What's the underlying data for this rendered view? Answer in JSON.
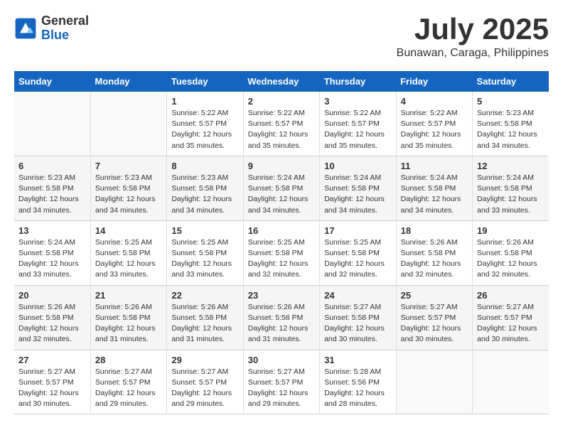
{
  "logo": {
    "general": "General",
    "blue": "Blue"
  },
  "title": {
    "month": "July 2025",
    "location": "Bunawan, Caraga, Philippines"
  },
  "days_of_week": [
    "Sunday",
    "Monday",
    "Tuesday",
    "Wednesday",
    "Thursday",
    "Friday",
    "Saturday"
  ],
  "weeks": [
    [
      {
        "day": "",
        "info": ""
      },
      {
        "day": "",
        "info": ""
      },
      {
        "day": "1",
        "info": "Sunrise: 5:22 AM\nSunset: 5:57 PM\nDaylight: 12 hours and 35 minutes."
      },
      {
        "day": "2",
        "info": "Sunrise: 5:22 AM\nSunset: 5:57 PM\nDaylight: 12 hours and 35 minutes."
      },
      {
        "day": "3",
        "info": "Sunrise: 5:22 AM\nSunset: 5:57 PM\nDaylight: 12 hours and 35 minutes."
      },
      {
        "day": "4",
        "info": "Sunrise: 5:22 AM\nSunset: 5:57 PM\nDaylight: 12 hours and 35 minutes."
      },
      {
        "day": "5",
        "info": "Sunrise: 5:23 AM\nSunset: 5:58 PM\nDaylight: 12 hours and 34 minutes."
      }
    ],
    [
      {
        "day": "6",
        "info": "Sunrise: 5:23 AM\nSunset: 5:58 PM\nDaylight: 12 hours and 34 minutes."
      },
      {
        "day": "7",
        "info": "Sunrise: 5:23 AM\nSunset: 5:58 PM\nDaylight: 12 hours and 34 minutes."
      },
      {
        "day": "8",
        "info": "Sunrise: 5:23 AM\nSunset: 5:58 PM\nDaylight: 12 hours and 34 minutes."
      },
      {
        "day": "9",
        "info": "Sunrise: 5:24 AM\nSunset: 5:58 PM\nDaylight: 12 hours and 34 minutes."
      },
      {
        "day": "10",
        "info": "Sunrise: 5:24 AM\nSunset: 5:58 PM\nDaylight: 12 hours and 34 minutes."
      },
      {
        "day": "11",
        "info": "Sunrise: 5:24 AM\nSunset: 5:58 PM\nDaylight: 12 hours and 34 minutes."
      },
      {
        "day": "12",
        "info": "Sunrise: 5:24 AM\nSunset: 5:58 PM\nDaylight: 12 hours and 33 minutes."
      }
    ],
    [
      {
        "day": "13",
        "info": "Sunrise: 5:24 AM\nSunset: 5:58 PM\nDaylight: 12 hours and 33 minutes."
      },
      {
        "day": "14",
        "info": "Sunrise: 5:25 AM\nSunset: 5:58 PM\nDaylight: 12 hours and 33 minutes."
      },
      {
        "day": "15",
        "info": "Sunrise: 5:25 AM\nSunset: 5:58 PM\nDaylight: 12 hours and 33 minutes."
      },
      {
        "day": "16",
        "info": "Sunrise: 5:25 AM\nSunset: 5:58 PM\nDaylight: 12 hours and 32 minutes."
      },
      {
        "day": "17",
        "info": "Sunrise: 5:25 AM\nSunset: 5:58 PM\nDaylight: 12 hours and 32 minutes."
      },
      {
        "day": "18",
        "info": "Sunrise: 5:26 AM\nSunset: 5:58 PM\nDaylight: 12 hours and 32 minutes."
      },
      {
        "day": "19",
        "info": "Sunrise: 5:26 AM\nSunset: 5:58 PM\nDaylight: 12 hours and 32 minutes."
      }
    ],
    [
      {
        "day": "20",
        "info": "Sunrise: 5:26 AM\nSunset: 5:58 PM\nDaylight: 12 hours and 32 minutes."
      },
      {
        "day": "21",
        "info": "Sunrise: 5:26 AM\nSunset: 5:58 PM\nDaylight: 12 hours and 31 minutes."
      },
      {
        "day": "22",
        "info": "Sunrise: 5:26 AM\nSunset: 5:58 PM\nDaylight: 12 hours and 31 minutes."
      },
      {
        "day": "23",
        "info": "Sunrise: 5:26 AM\nSunset: 5:58 PM\nDaylight: 12 hours and 31 minutes."
      },
      {
        "day": "24",
        "info": "Sunrise: 5:27 AM\nSunset: 5:58 PM\nDaylight: 12 hours and 30 minutes."
      },
      {
        "day": "25",
        "info": "Sunrise: 5:27 AM\nSunset: 5:57 PM\nDaylight: 12 hours and 30 minutes."
      },
      {
        "day": "26",
        "info": "Sunrise: 5:27 AM\nSunset: 5:57 PM\nDaylight: 12 hours and 30 minutes."
      }
    ],
    [
      {
        "day": "27",
        "info": "Sunrise: 5:27 AM\nSunset: 5:57 PM\nDaylight: 12 hours and 30 minutes."
      },
      {
        "day": "28",
        "info": "Sunrise: 5:27 AM\nSunset: 5:57 PM\nDaylight: 12 hours and 29 minutes."
      },
      {
        "day": "29",
        "info": "Sunrise: 5:27 AM\nSunset: 5:57 PM\nDaylight: 12 hours and 29 minutes."
      },
      {
        "day": "30",
        "info": "Sunrise: 5:27 AM\nSunset: 5:57 PM\nDaylight: 12 hours and 29 minutes."
      },
      {
        "day": "31",
        "info": "Sunrise: 5:28 AM\nSunset: 5:56 PM\nDaylight: 12 hours and 28 minutes."
      },
      {
        "day": "",
        "info": ""
      },
      {
        "day": "",
        "info": ""
      }
    ]
  ]
}
